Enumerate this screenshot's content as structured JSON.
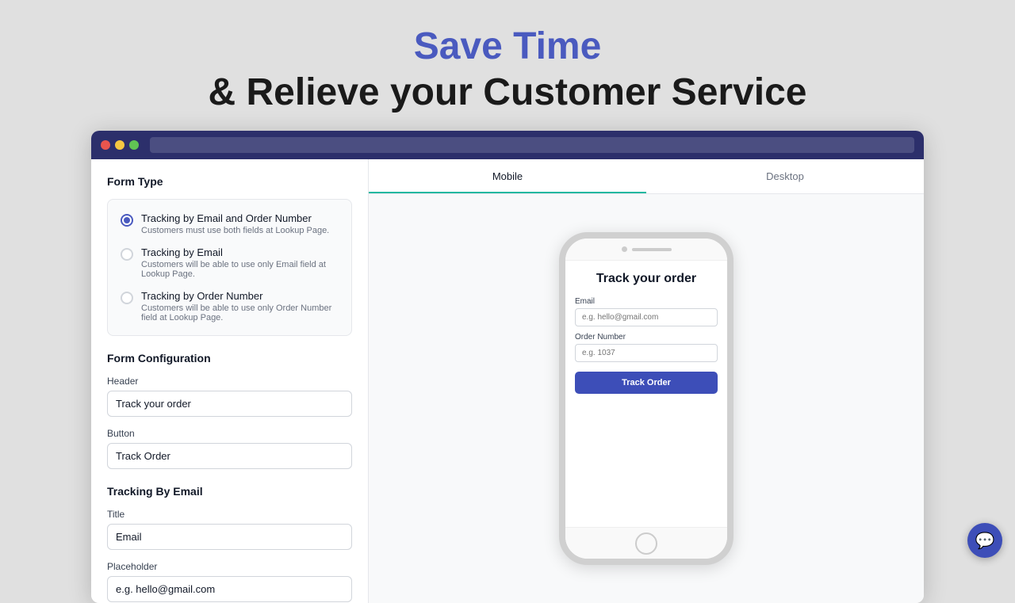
{
  "page": {
    "headline_colored": "Save Time",
    "headline_dark": "& Relieve your Customer Service"
  },
  "browser": {
    "address_placeholder": ""
  },
  "left_panel": {
    "form_type_section_title": "Form Type",
    "form_config_section_title": "Form Configuration",
    "tracking_email_section_title": "Tracking By Email",
    "radio_options": [
      {
        "id": "email-and-order",
        "label": "Tracking by Email and Order Number",
        "desc": "Customers must use both fields at Lookup Page.",
        "checked": true
      },
      {
        "id": "email-only",
        "label": "Tracking by Email",
        "desc": "Customers will be able to use only Email field at Lookup Page.",
        "checked": false
      },
      {
        "id": "order-only",
        "label": "Tracking by Order Number",
        "desc": "Customers will be able to use only Order Number field at Lookup Page.",
        "checked": false
      }
    ],
    "header_label": "Header",
    "header_value": "Track your order",
    "button_label": "Button",
    "button_value": "Track Order",
    "title_label": "Title",
    "title_value": "Email",
    "placeholder_label": "Placeholder",
    "placeholder_value": "e.g. hello@gmail.com"
  },
  "right_panel": {
    "tabs": [
      {
        "id": "mobile",
        "label": "Mobile",
        "active": true
      },
      {
        "id": "desktop",
        "label": "Desktop",
        "active": false
      }
    ]
  },
  "phone": {
    "form_title": "Track your order",
    "email_label": "Email",
    "email_placeholder": "e.g. hello@gmail.com",
    "order_number_label": "Order Number",
    "order_number_placeholder": "e.g. 1037",
    "track_button": "Track Order"
  }
}
